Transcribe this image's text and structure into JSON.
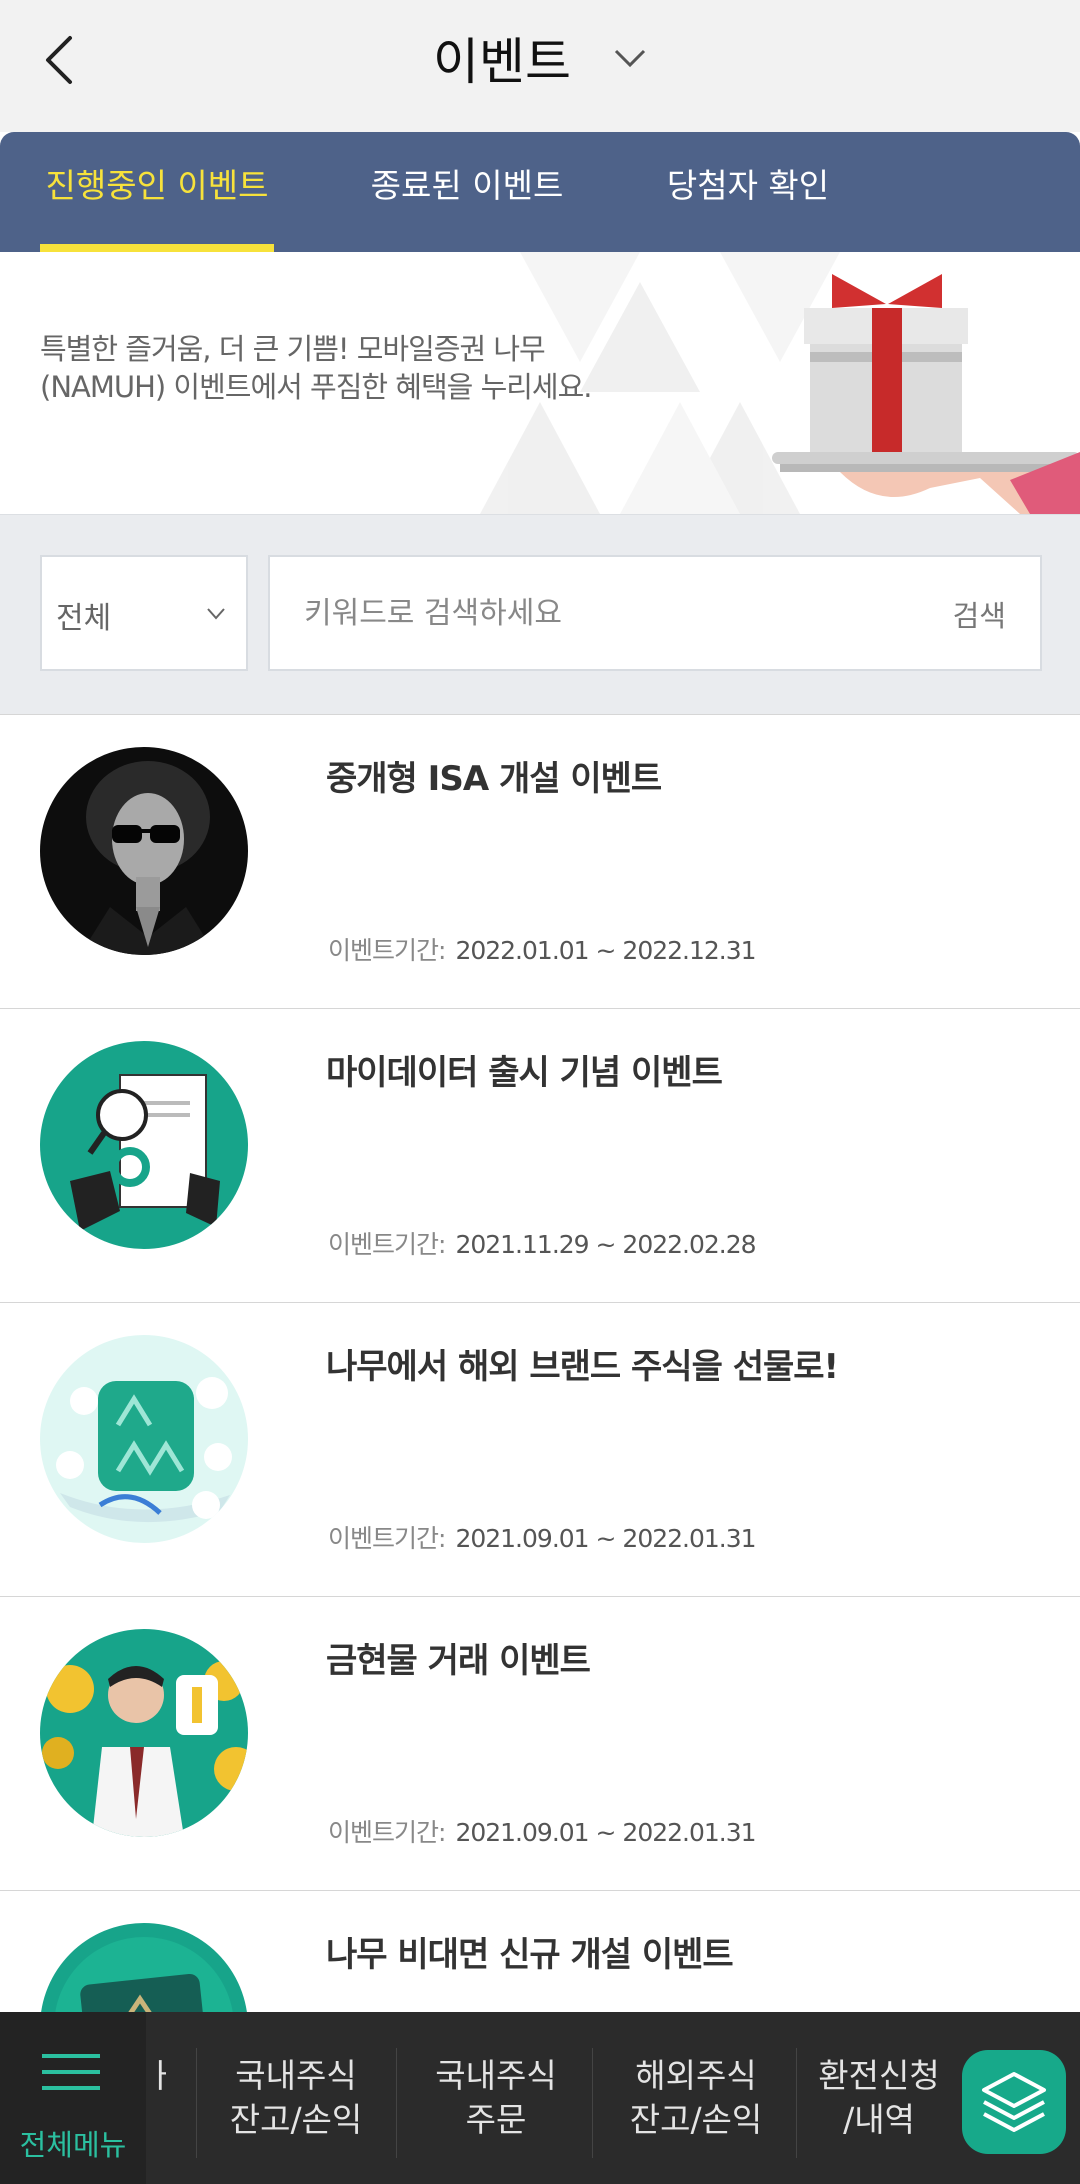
{
  "header": {
    "title": "이벤트"
  },
  "tabs": [
    {
      "label": "진행중인 이벤트",
      "active": true
    },
    {
      "label": "종료된 이벤트",
      "active": false
    },
    {
      "label": "당첨자 확인",
      "active": false
    }
  ],
  "banner": {
    "line1": "특별한 즐거움, 더 큰 기쁨! 모바일증권 나무",
    "line2": "(NAMUH) 이벤트에서 푸짐한 혜택을 누리세요."
  },
  "search": {
    "filter_value": "전체",
    "placeholder": "키워드로 검색하세요",
    "button_label": "검색"
  },
  "period_label": "이벤트기간:",
  "events": [
    {
      "title": "중개형 ISA 개설 이벤트",
      "period": "2022.01.01 ~ 2022.12.31",
      "thumb": "woman-sunglasses"
    },
    {
      "title": "마이데이터 출시 기념 이벤트",
      "period": "2021.11.29 ~ 2022.02.28",
      "thumb": "mydata-document"
    },
    {
      "title": "나무에서 해외 브랜드 주식을 선물로!",
      "period": "2021.09.01 ~ 2022.01.31",
      "thumb": "namuh-brand-gift"
    },
    {
      "title": "금현물 거래 이벤트",
      "period": "2021.09.01 ~ 2022.01.31",
      "thumb": "man-gold-coins"
    },
    {
      "title": "나무 비대면 신규 개설 이벤트",
      "period": "",
      "thumb": "namuh-card"
    }
  ],
  "bottom_nav": {
    "menu_label": "전체메뉴",
    "partial_left": "ㅏ",
    "items": [
      {
        "line1": "국내주식",
        "line2": "잔고/손익"
      },
      {
        "line1": "국내주식",
        "line2": "주문"
      },
      {
        "line1": "해외주식",
        "line2": "잔고/손익"
      },
      {
        "line1": "환전신청",
        "line2": "/내역"
      }
    ]
  },
  "colors": {
    "tab_bar": "#4e6289",
    "tab_active": "#f7e23b",
    "brand_green": "#17a98a",
    "nav_bg": "#2b2b2b"
  }
}
